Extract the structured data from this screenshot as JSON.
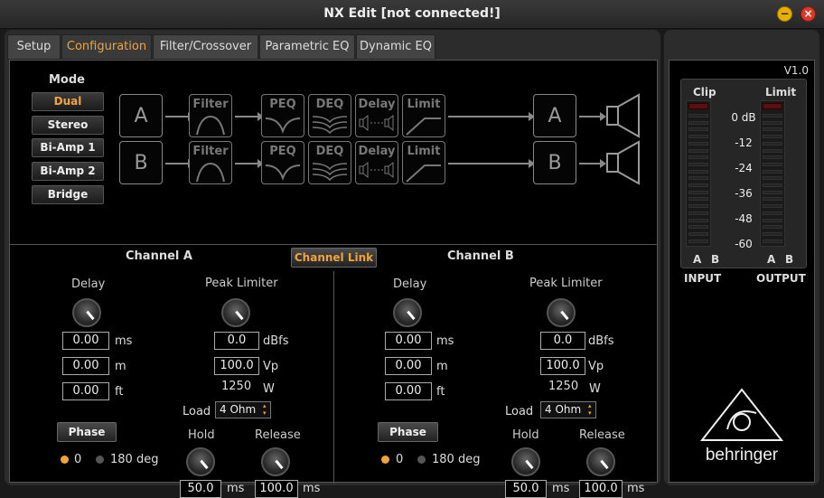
{
  "app": {
    "title": "NX Edit [not connected!]"
  },
  "tabs": [
    "Setup",
    "Configuration",
    "Filter/Crossover",
    "Parametric EQ",
    "Dynamic EQ"
  ],
  "mode": {
    "label": "Mode",
    "options": [
      "Dual",
      "Stereo",
      "Bi-Amp 1",
      "Bi-Amp 2",
      "Bridge"
    ],
    "selected": "Dual"
  },
  "flow": {
    "input_a": "A",
    "input_b": "B",
    "filter": "Filter",
    "peq": "PEQ",
    "deq": "DEQ",
    "delay": "Delay",
    "limit": "Limit",
    "output_a": "A",
    "output_b": "B"
  },
  "channel_link": "Channel Link",
  "channel_a": {
    "title": "Channel A",
    "delay_label": "Delay",
    "delay_ms": "0.00",
    "delay_m": "0.00",
    "delay_ft": "0.00",
    "unit_ms": "ms",
    "unit_m": "m",
    "unit_ft": "ft",
    "limiter_label": "Peak Limiter",
    "dbfs": "0.0",
    "unit_dbfs": "dBfs",
    "vp": "100.0",
    "unit_vp": "Vp",
    "watts": "1250",
    "unit_w": "W",
    "load_label": "Load",
    "load_value": "4 Ohm",
    "phase_button": "Phase",
    "phase_0": "0",
    "phase_180": "180 deg",
    "phase_selected": "0",
    "hold_label": "Hold",
    "hold_value": "50.0",
    "hold_unit": "ms",
    "release_label": "Release",
    "release_value": "100.0",
    "release_unit": "ms"
  },
  "channel_b": {
    "title": "Channel B",
    "delay_label": "Delay",
    "delay_ms": "0.00",
    "delay_m": "0.00",
    "delay_ft": "0.00",
    "unit_ms": "ms",
    "unit_m": "m",
    "unit_ft": "ft",
    "limiter_label": "Peak Limiter",
    "dbfs": "0.0",
    "unit_dbfs": "dBfs",
    "vp": "100.0",
    "unit_vp": "Vp",
    "watts": "1250",
    "unit_w": "W",
    "load_label": "Load",
    "load_value": "4 Ohm",
    "phase_button": "Phase",
    "phase_0": "0",
    "phase_180": "180 deg",
    "phase_selected": "0",
    "hold_label": "Hold",
    "hold_value": "50.0",
    "hold_unit": "ms",
    "release_label": "Release",
    "release_value": "100.0",
    "release_unit": "ms"
  },
  "meters": {
    "version": "V1.0",
    "clip": "Clip",
    "limit": "Limit",
    "scale": [
      "0 dB",
      "-12",
      "-24",
      "-36",
      "-48",
      "-60"
    ],
    "in_a": "A",
    "in_b": "B",
    "out_a": "A",
    "out_b": "B",
    "input_label": "INPUT",
    "output_label": "OUTPUT"
  },
  "brand": "behringer",
  "colors": {
    "accent": "#f2a33a",
    "close": "#d83a2a",
    "minimize": "#e8b000"
  }
}
